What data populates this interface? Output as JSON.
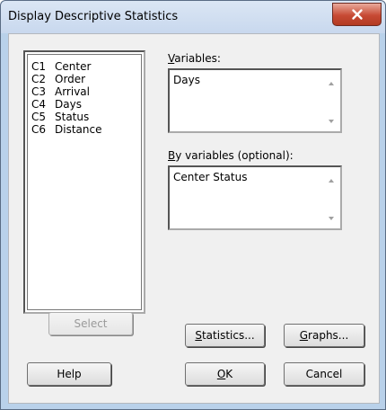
{
  "window": {
    "title": "Display Descriptive Statistics"
  },
  "columns": [
    {
      "id": "C1",
      "name": "Center"
    },
    {
      "id": "C2",
      "name": "Order"
    },
    {
      "id": "C3",
      "name": "Arrival"
    },
    {
      "id": "C4",
      "name": "Days"
    },
    {
      "id": "C5",
      "name": "Status"
    },
    {
      "id": "C6",
      "name": "Distance"
    }
  ],
  "variables": {
    "label_u": "V",
    "label_rest": "ariables:",
    "value": "Days"
  },
  "by_variables": {
    "label_u": "B",
    "label_rest": "y variables (optional):",
    "value": "Center Status"
  },
  "buttons": {
    "select": "Select",
    "statistics_u": "S",
    "statistics_rest": "tatistics...",
    "graphs_u": "G",
    "graphs_rest": "raphs...",
    "help": "Help",
    "ok_u": "O",
    "ok_rest": "K",
    "cancel": "Cancel"
  }
}
